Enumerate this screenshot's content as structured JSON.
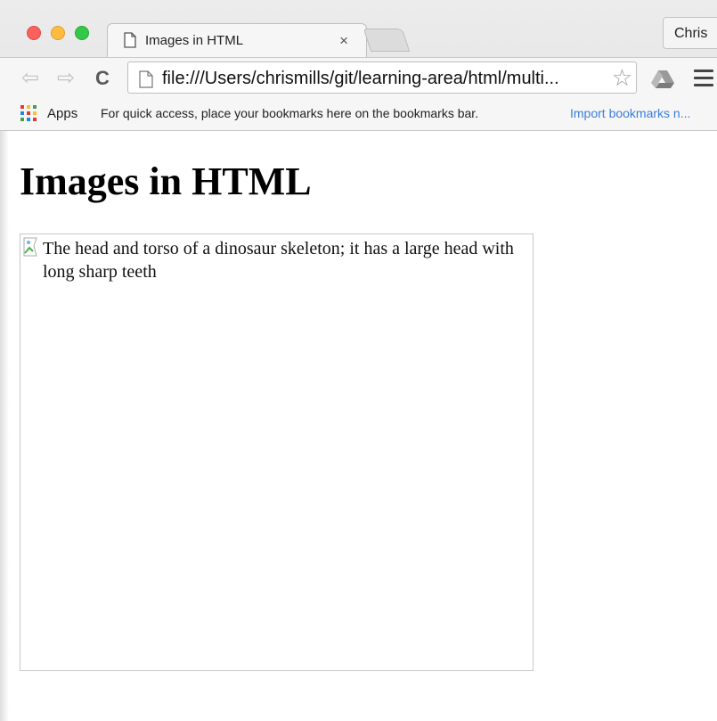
{
  "tab": {
    "title": "Images in HTML",
    "close_glyph": "×"
  },
  "profile": {
    "name": "Chris"
  },
  "toolbar": {
    "back_glyph": "⇦",
    "forward_glyph": "⇨",
    "reload_glyph": "C",
    "url": "file:///Users/chrismills/git/learning-area/html/multi...",
    "star_glyph": "☆"
  },
  "bookmarks_bar": {
    "apps_label": "Apps",
    "hint": "For quick access, place your bookmarks here on the bookmarks bar.",
    "import_link": "Import bookmarks n..."
  },
  "page": {
    "heading": "Images in HTML",
    "image_alt": "The head and torso of a dinosaur skeleton; it has a large head with long sharp teeth"
  },
  "icons": [
    "close-icon",
    "page-icon",
    "star-icon",
    "drive-icon",
    "menu-icon",
    "apps-icon",
    "broken-image-icon"
  ],
  "colors": {
    "close_red": "#fc605c",
    "minimize_yellow": "#fdbc40",
    "zoom_green": "#34c84a",
    "link_blue": "#3b7ddd"
  }
}
